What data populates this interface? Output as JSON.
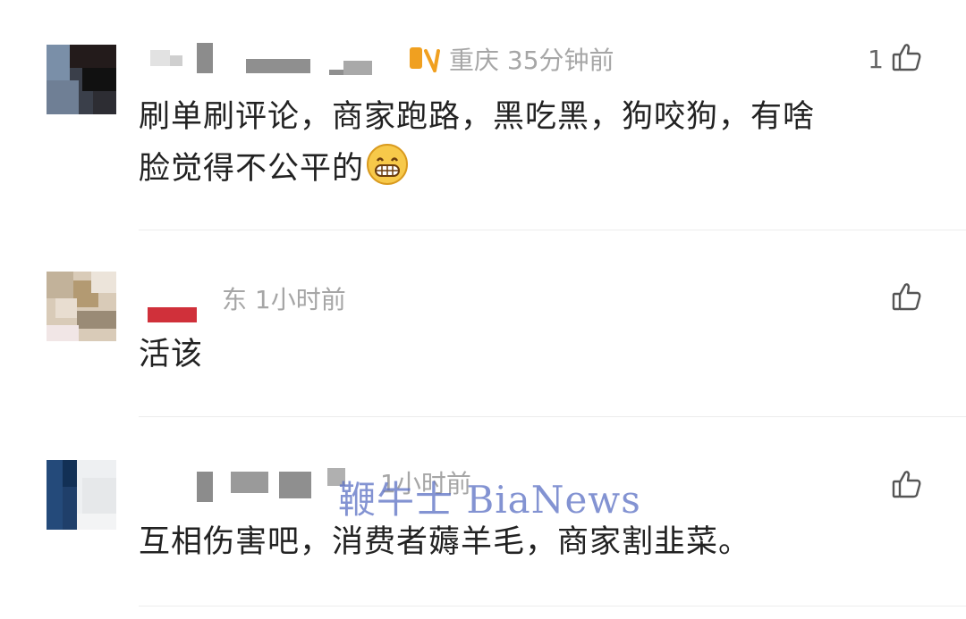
{
  "comments": [
    {
      "meta": "重庆 35分钟前",
      "likes": "1",
      "text_line1": "刷单刷评论，商家跑路，黑吃黑，狗咬狗，有啥",
      "text_line2": "脸觉得不公平的",
      "emoji": "grinning-face-icon"
    },
    {
      "meta": "东 1小时前",
      "likes": "",
      "text_line1": "活该"
    },
    {
      "meta": "1小时前",
      "likes": "",
      "text_line1": "互相伤害吧，消费者薅羊毛，商家割韭菜。"
    }
  ],
  "watermark": "鞭牛士 BiaNews",
  "colors": {
    "meta": "#a6a6a6",
    "text": "#222222",
    "divider": "#ececec",
    "watermark": "#5a6fc4",
    "location_badge": "#f0a020",
    "username_red": "#d0303a"
  }
}
